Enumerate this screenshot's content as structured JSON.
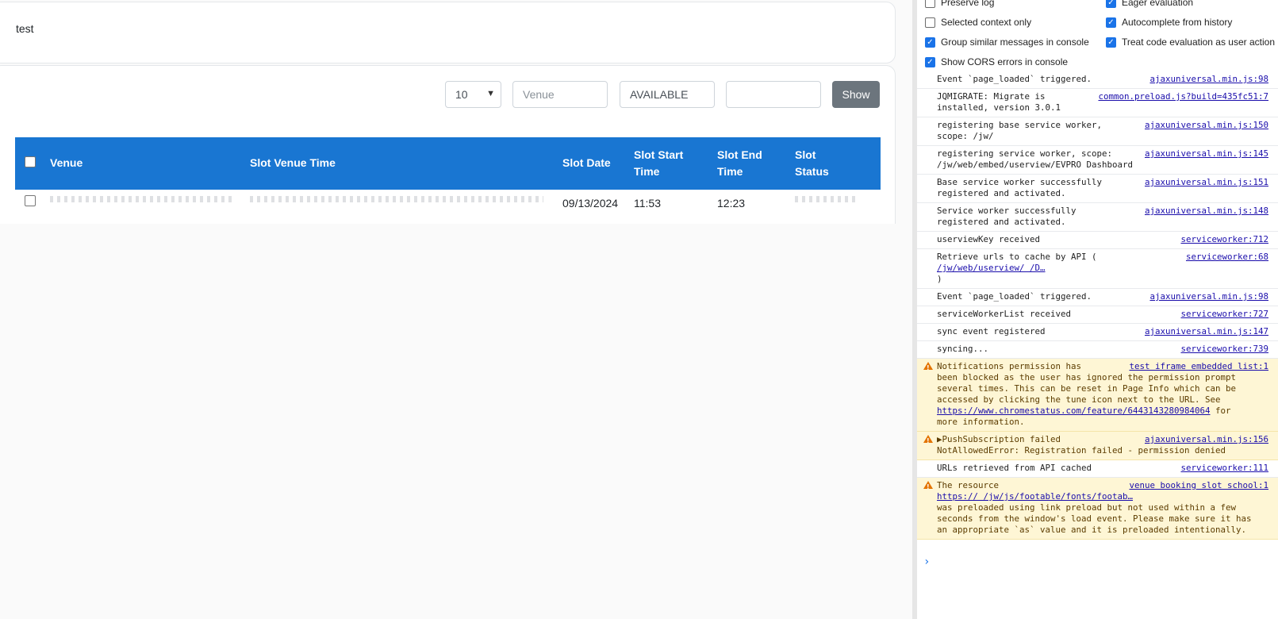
{
  "page": {
    "title": "test",
    "filters": {
      "page_length": "10",
      "venue_placeholder": "Venue",
      "status_value": "AVAILABLE",
      "date_value": "",
      "show_label": "Show"
    },
    "table": {
      "columns": [
        "Venue",
        "Slot Venue Time",
        "Slot Date",
        "Slot Start Time",
        "Slot End Time",
        "Slot Status"
      ],
      "columns_wrapped": {
        "slot_start": [
          "Slot Start",
          "Time"
        ],
        "slot_end": [
          "Slot End",
          "Time"
        ],
        "slot_status": [
          "Slot",
          "Status"
        ]
      },
      "rows": [
        {
          "slot_date": "09/13/2024",
          "slot_start": "11:53",
          "slot_end": "12:23"
        }
      ]
    }
  },
  "devtools": {
    "settings_left": [
      {
        "label": "Preserve log",
        "checked": false
      },
      {
        "label": "Selected context only",
        "checked": false
      },
      {
        "label": "Group similar messages in console",
        "checked": true
      },
      {
        "label": "Show CORS errors in console",
        "checked": true
      }
    ],
    "settings_right": [
      {
        "label": "Eager evaluation",
        "checked": true
      },
      {
        "label": "Autocomplete from history",
        "checked": true
      },
      {
        "label": "Treat code evaluation as user action",
        "checked": true
      }
    ],
    "messages": [
      {
        "lines": [
          "Event `page_loaded` triggered."
        ],
        "source": "ajaxuniversal.min.js:98"
      },
      {
        "lines": [
          "JQMIGRATE: Migrate is",
          "installed, version 3.0.1"
        ],
        "source": "common.preload.js?build=435fc51:7"
      },
      {
        "lines": [
          "registering base service worker,",
          "scope: /jw/"
        ],
        "source": "ajaxuniversal.min.js:150"
      },
      {
        "lines": [
          "registering service worker, scope:",
          "/jw/web/embed/userview/EVPRO   Dashboard"
        ],
        "source": "ajaxuniversal.min.js:145"
      },
      {
        "lines": [
          "Base service worker successfully",
          "registered and activated."
        ],
        "source": "ajaxuniversal.min.js:151"
      },
      {
        "lines": [
          "Service worker successfully",
          "registered and activated."
        ],
        "source": "ajaxuniversal.min.js:148"
      },
      {
        "lines": [
          "userviewKey received"
        ],
        "source": "serviceworker:712"
      },
      {
        "lines": [
          "Retrieve urls to cache by API (",
          "/jw/web/userview/   /D…",
          ")"
        ],
        "source": "serviceworker:68"
      },
      {
        "lines": [
          "Event `page_loaded` triggered."
        ],
        "source": "ajaxuniversal.min.js:98"
      },
      {
        "lines": [
          "serviceWorkerList received"
        ],
        "source": "serviceworker:727"
      },
      {
        "lines": [
          "sync event registered"
        ],
        "source": "ajaxuniversal.min.js:147"
      },
      {
        "lines": [
          "syncing..."
        ],
        "source": "serviceworker:739"
      }
    ],
    "warn_notifications": {
      "text_1": "Notifications permission has",
      "text_2": "been blocked as the user has ignored the permission prompt",
      "text_3": "several times. This can be reset in Page Info which can be",
      "text_4": "accessed by clicking the tune icon next to the URL. See",
      "link": "https://www.chromestatus.com/feature/6443143280984064",
      "text_5": " for",
      "text_6": "more information.",
      "source": "test iframe embedded list:1"
    },
    "warn_push": {
      "text_1": "▶PushSubscription failed",
      "text_2": "NotAllowedError: Registration failed - permission denied",
      "source": "ajaxuniversal.min.js:156"
    },
    "msg_urls": {
      "text": "URLs retrieved from API cached",
      "source": "serviceworker:111"
    },
    "warn_preload": {
      "text_1": "The resource",
      "link": "https://               /jw/js/footable/fonts/footab…",
      "text_2": "was preloaded using link preload but not used within a few",
      "text_3": "seconds from the window's load event. Please make sure it has",
      "text_4": "an appropriate `as` value and it is preloaded intentionally.",
      "source": "venue booking slot school:1"
    },
    "prompt": "›"
  }
}
